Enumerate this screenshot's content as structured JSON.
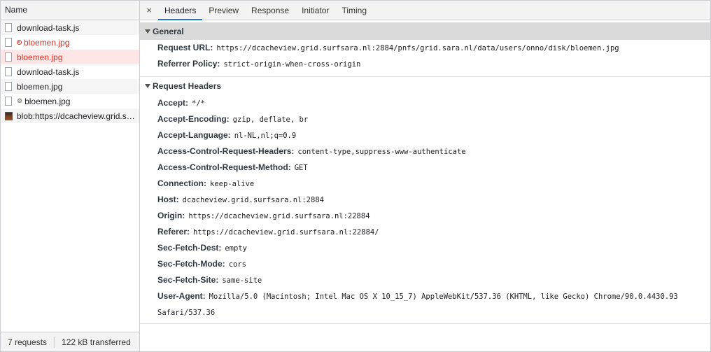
{
  "list": {
    "header": "Name",
    "items": [
      {
        "name": "download-task.js",
        "error": false,
        "icon": "file-icon"
      },
      {
        "name": "bloemen.jpg",
        "error": true,
        "icon": "file-icon"
      },
      {
        "name": "bloemen.jpg",
        "error": true,
        "selected": true,
        "icon": "file-icon"
      },
      {
        "name": "download-task.js",
        "error": false,
        "icon": "file-icon"
      },
      {
        "name": "bloemen.jpg",
        "error": false,
        "icon": "file-icon"
      },
      {
        "name": "bloemen.jpg",
        "error": false,
        "gear": true,
        "icon": "file-icon"
      },
      {
        "name": "blob:https://dcacheview.grid.surfsara.nl:22884/...",
        "error": false,
        "icon": "image-icon"
      }
    ],
    "requests": "7 requests",
    "transferred": "122 kB transferred"
  },
  "tabs": {
    "close": "×",
    "items": [
      "Headers",
      "Preview",
      "Response",
      "Initiator",
      "Timing"
    ],
    "active": "Headers"
  },
  "general": {
    "title": "General",
    "rows": [
      {
        "key": "Request URL:",
        "value": "https://dcacheview.grid.surfsara.nl:2884/pnfs/grid.sara.nl/data/users/onno/disk/bloemen.jpg"
      },
      {
        "key": "Referrer Policy:",
        "value": "strict-origin-when-cross-origin"
      }
    ]
  },
  "request_headers": {
    "title": "Request Headers",
    "rows": [
      {
        "key": "Accept:",
        "value": "*/*"
      },
      {
        "key": "Accept-Encoding:",
        "value": "gzip, deflate, br"
      },
      {
        "key": "Accept-Language:",
        "value": "nl-NL,nl;q=0.9"
      },
      {
        "key": "Access-Control-Request-Headers:",
        "value": "content-type,suppress-www-authenticate"
      },
      {
        "key": "Access-Control-Request-Method:",
        "value": "GET"
      },
      {
        "key": "Connection:",
        "value": "keep-alive"
      },
      {
        "key": "Host:",
        "value": "dcacheview.grid.surfsara.nl:2884"
      },
      {
        "key": "Origin:",
        "value": "https://dcacheview.grid.surfsara.nl:22884"
      },
      {
        "key": "Referer:",
        "value": "https://dcacheview.grid.surfsara.nl:22884/"
      },
      {
        "key": "Sec-Fetch-Dest:",
        "value": "empty"
      },
      {
        "key": "Sec-Fetch-Mode:",
        "value": "cors"
      },
      {
        "key": "Sec-Fetch-Site:",
        "value": "same-site"
      },
      {
        "key": "User-Agent:",
        "value": "Mozilla/5.0 (Macintosh; Intel Mac OS X 10_15_7) AppleWebKit/537.36 (KHTML, like Gecko) Chrome/90.0.4430.93 Safari/537.36"
      }
    ]
  },
  "colors": {
    "error_text": "#d93025",
    "selected_row": "#fde6e5",
    "active_tab_underline": "#1a73e8",
    "general_header_bg": "#dadada"
  }
}
